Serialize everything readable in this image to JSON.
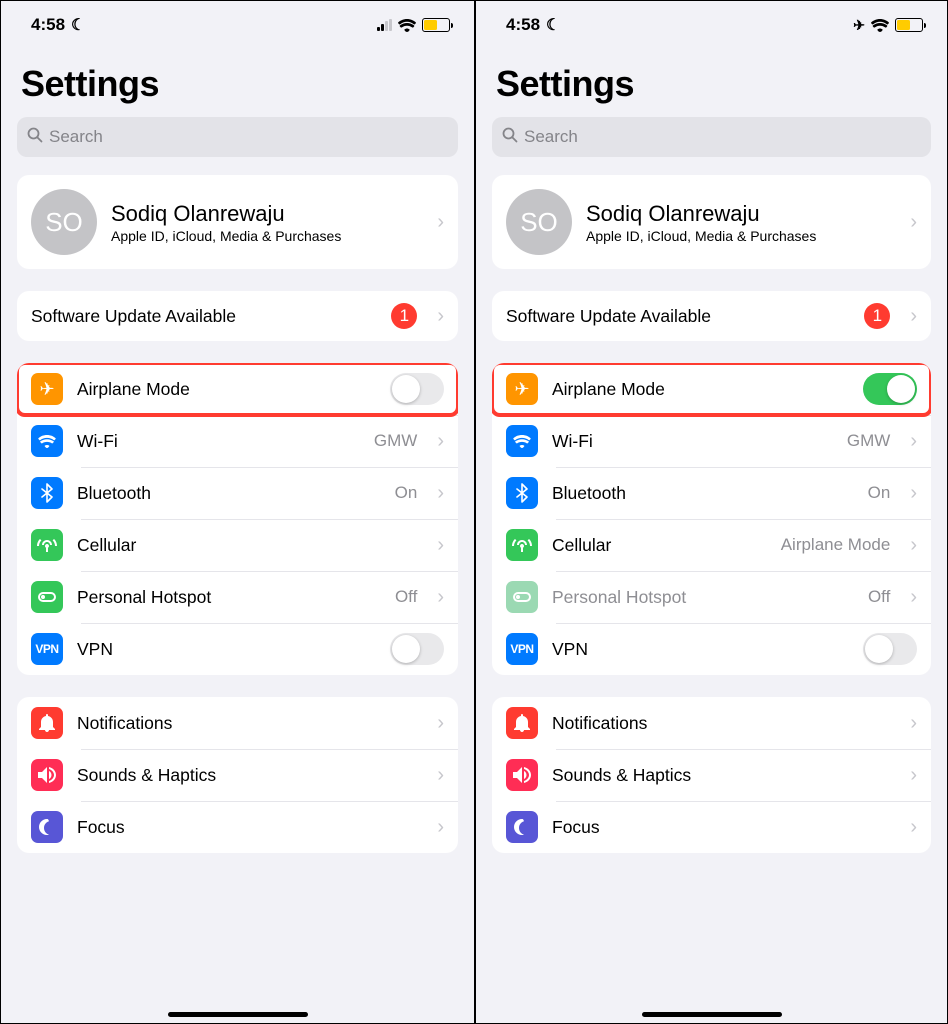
{
  "status": {
    "time": "4:58"
  },
  "title": "Settings",
  "search": {
    "placeholder": "Search"
  },
  "profile": {
    "initials": "SO",
    "name": "Sodiq Olanrewaju",
    "subtitle": "Apple ID, iCloud, Media & Purchases"
  },
  "software_update": {
    "label": "Software Update Available",
    "badge": "1"
  },
  "groupA": {
    "airplane": "Airplane Mode",
    "wifi": {
      "label": "Wi-Fi",
      "detail": "GMW"
    },
    "bluetooth": {
      "label": "Bluetooth",
      "detail": "On"
    },
    "cellular": {
      "label": "Cellular",
      "detail_on": "Airplane Mode"
    },
    "hotspot": {
      "label": "Personal Hotspot",
      "detail": "Off"
    },
    "vpn": {
      "label": "VPN",
      "text": "VPN"
    }
  },
  "groupB": {
    "notifications": "Notifications",
    "sounds": "Sounds & Haptics",
    "focus": "Focus"
  }
}
